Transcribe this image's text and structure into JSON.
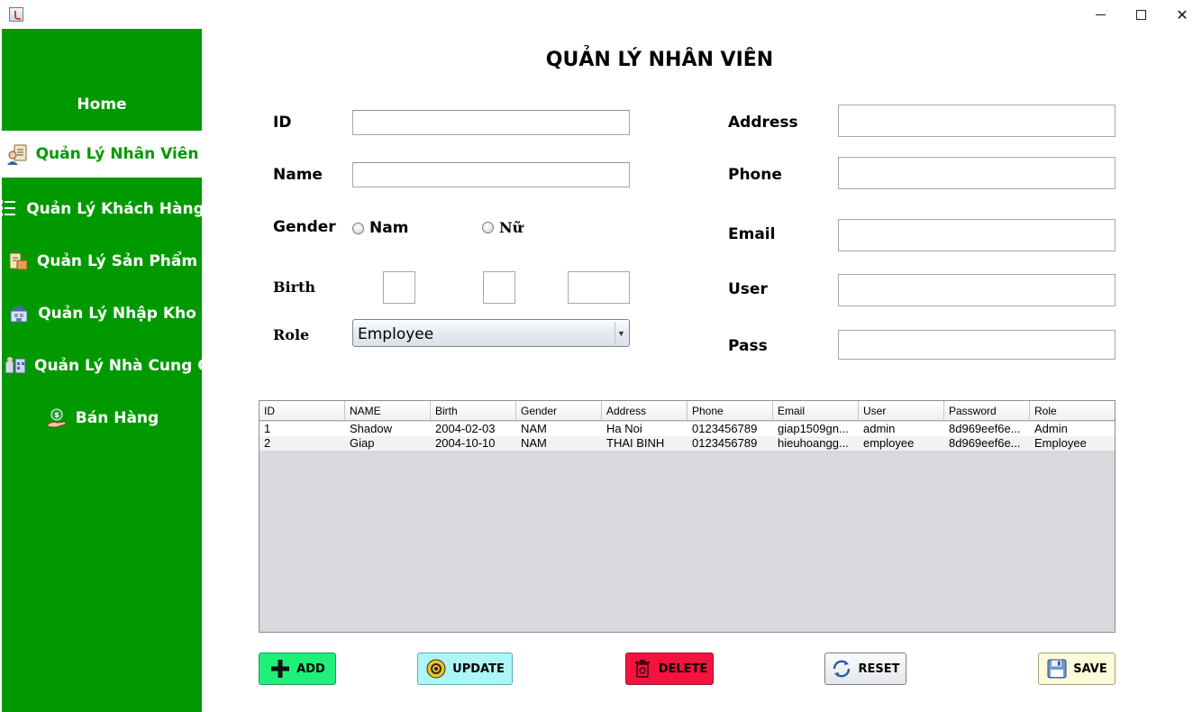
{
  "window": {
    "minimize": "",
    "maximize": "",
    "close": "✕"
  },
  "sidebar": {
    "items": [
      {
        "label": "Home",
        "icon": "",
        "active": false
      },
      {
        "label": "Quản Lý Nhân Viên",
        "icon": "employee-icon",
        "active": true
      },
      {
        "label": "Quản Lý Khách Hàng",
        "icon": "customer-list-icon",
        "active": false
      },
      {
        "label": "Quản Lý Sản Phẩm",
        "icon": "product-icon",
        "active": false
      },
      {
        "label": "Quản Lý Nhập Kho",
        "icon": "warehouse-icon",
        "active": false
      },
      {
        "label": "Quản Lý Nhà Cung Cấp",
        "icon": "supplier-icon",
        "active": false
      },
      {
        "label": "Bán Hàng",
        "icon": "sales-icon",
        "active": false
      }
    ]
  },
  "page": {
    "title": "QUẢN LÝ NHÂN VIÊN"
  },
  "form": {
    "id": {
      "label": "ID",
      "value": ""
    },
    "name": {
      "label": "Name",
      "value": ""
    },
    "gender": {
      "label": "Gender",
      "options": [
        "Nam",
        "Nữ"
      ],
      "selected": null
    },
    "birth": {
      "label": "Birth",
      "day": "",
      "month": "",
      "year": ""
    },
    "role": {
      "label": "Role",
      "value": "Employee"
    },
    "address": {
      "label": "Address",
      "value": ""
    },
    "phone": {
      "label": "Phone",
      "value": ""
    },
    "email": {
      "label": "Email",
      "value": ""
    },
    "user": {
      "label": "User",
      "value": ""
    },
    "pass": {
      "label": "Pass",
      "value": ""
    }
  },
  "table": {
    "columns": [
      "ID",
      "NAME",
      "Birth",
      "Gender",
      "Address",
      "Phone",
      "Email",
      "User",
      "Password",
      "Role"
    ],
    "rows": [
      [
        "1",
        "Shadow",
        "2004-02-03",
        "NAM",
        "Ha Noi",
        "0123456789",
        "giap1509gn...",
        "admin",
        "8d969eef6e...",
        "Admin"
      ],
      [
        "2",
        "Giap",
        "2004-10-10",
        "NAM",
        "THAI BINH",
        "0123456789",
        "hieuhoangg...",
        "employee",
        "8d969eef6e...",
        "Employee"
      ]
    ]
  },
  "buttons": {
    "add": "ADD",
    "update": "UPDATE",
    "delete": "DELETE",
    "reset": "RESET",
    "save": "SAVE"
  },
  "colors": {
    "sidebar_bg": "#009a00",
    "add_bg": "#1ff07a",
    "update_bg": "#aef6f6",
    "delete_bg": "#f5123f",
    "save_bg": "#fdfbd8"
  }
}
